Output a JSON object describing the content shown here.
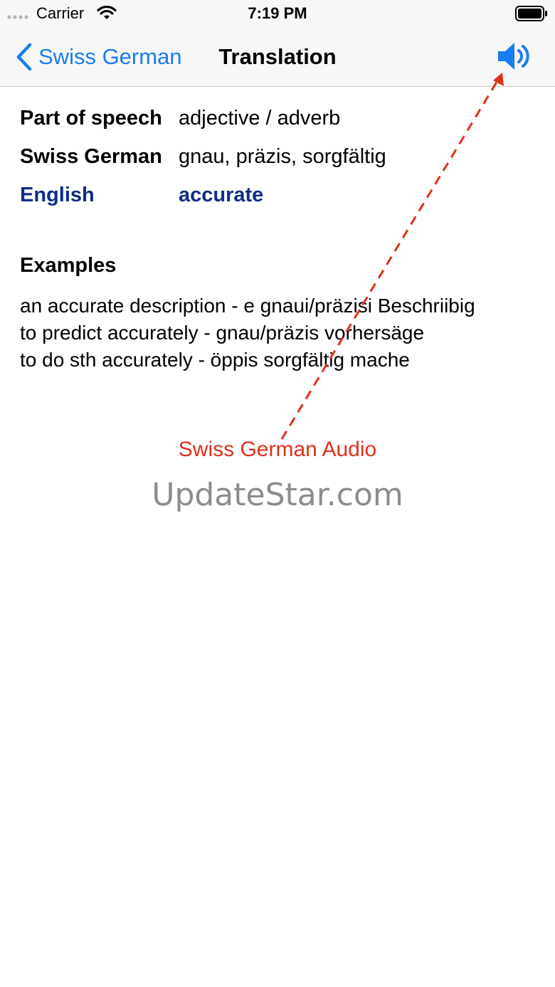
{
  "status_bar": {
    "carrier": "Carrier",
    "time": "7:19 PM"
  },
  "nav": {
    "back_label": "Swiss German",
    "title": "Translation",
    "audio_icon": "speaker-icon"
  },
  "details": [
    {
      "label": "Part of speech",
      "value": "adjective / adverb"
    },
    {
      "label": "Swiss German",
      "value": "gnau, präzis, sorgfältig"
    },
    {
      "label": "English",
      "value": "accurate"
    }
  ],
  "examples": {
    "title": "Examples",
    "items": [
      "an accurate description - e gnaui/präzisi Beschriibig",
      "to predict accurately - gnau/präzis vorhersäge",
      "to do sth accurately - öppis sorgfältig mache"
    ]
  },
  "annotation": {
    "label": "Swiss German Audio"
  },
  "watermark": "UpdateStar.com",
  "colors": {
    "accent": "#1a7cf2",
    "english_text": "#0f2d86",
    "annotation": "#e0301a",
    "watermark": "#8c8c8c"
  }
}
